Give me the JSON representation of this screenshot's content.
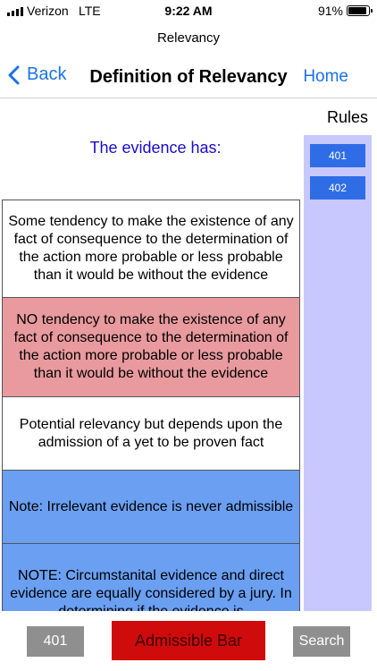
{
  "status_bar": {
    "carrier": "Verizon",
    "network": "LTE",
    "time": "9:22 AM",
    "battery_percent": "91%",
    "battery_level": 0.91
  },
  "app_title": "Relevancy",
  "nav": {
    "back_label": "Back",
    "title": "Definition of Relevancy",
    "home_label": "Home"
  },
  "content": {
    "header": "The evidence has:",
    "cards": [
      "Some tendency to make the existence of any fact of consequence to the determination of the action more probable or less probable than it would be without the evidence",
      "NO tendency to make the existence of any fact of consequence to the determination of the action more probable or less probable than it would be without the evidence",
      "Potential relevancy but depends upon the admission of a yet to be proven fact",
      "Note: Irrelevant evidence is never admissible",
      "NOTE: Circumstanital evidence and direct evidence are equally considered by a jury. In determining if the evidence is"
    ]
  },
  "rules": {
    "title": "Rules",
    "items": [
      "401",
      "402"
    ]
  },
  "bottom_bar": {
    "rule_button": "401",
    "admissible_label": "Admissible Bar",
    "search_label": "Search"
  },
  "colors": {
    "accent": "#1a73e8",
    "header_text": "#1a0dc8",
    "red_card": "#e89a9e",
    "blue_card": "#6a9ff2",
    "rules_panel": "#c8c8ff",
    "rule_button": "#2f6de6",
    "admissible_button": "#cf0b0b",
    "gray_button": "#8f8f8f"
  }
}
